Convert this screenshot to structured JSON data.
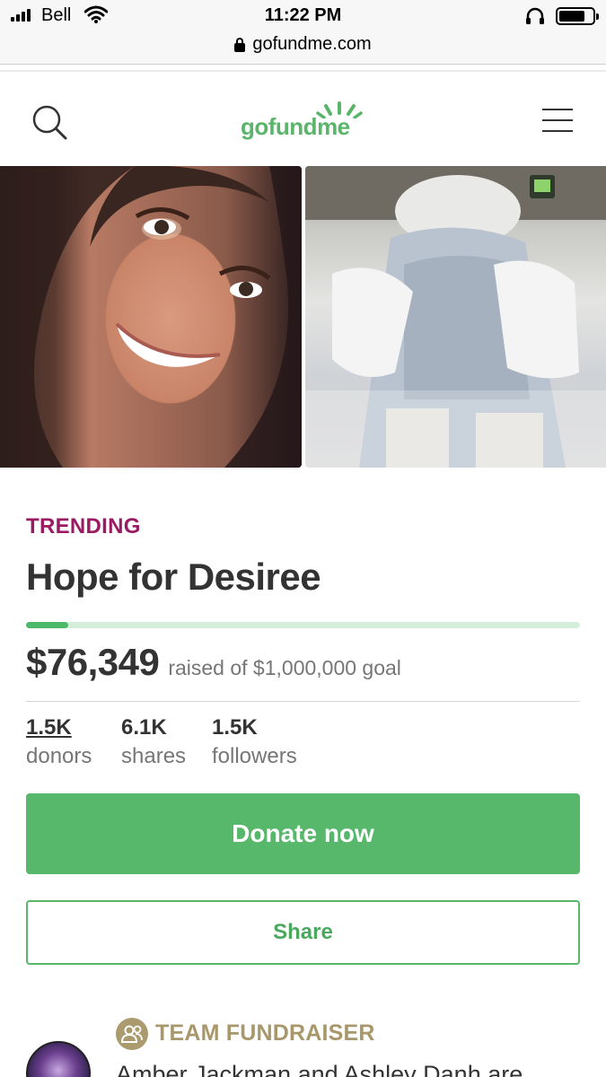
{
  "status_bar": {
    "carrier": "Bell",
    "time": "11:22 PM"
  },
  "browser": {
    "url": "gofundme.com"
  },
  "header": {
    "logo_text": "gofundme",
    "brand_color": "#5ab56a"
  },
  "campaign": {
    "tag": "TRENDING",
    "title": "Hope for Desiree",
    "raised": "$76,349",
    "goal_text": "raised of $1,000,000 goal",
    "progress_fraction": 0.076
  },
  "stats": [
    {
      "value": "1.5K",
      "label": "donors"
    },
    {
      "value": "6.1K",
      "label": "shares"
    },
    {
      "value": "1.5K",
      "label": "followers"
    }
  ],
  "actions": {
    "donate_label": "Donate now",
    "share_label": "Share"
  },
  "team": {
    "label": "TEAM FUNDRAISER",
    "description": "Amber Jackman and Ashley Danh are"
  },
  "colors": {
    "accent_green": "#57b86b",
    "trending_magenta": "#9b1b63",
    "team_gold": "#a8976b"
  }
}
